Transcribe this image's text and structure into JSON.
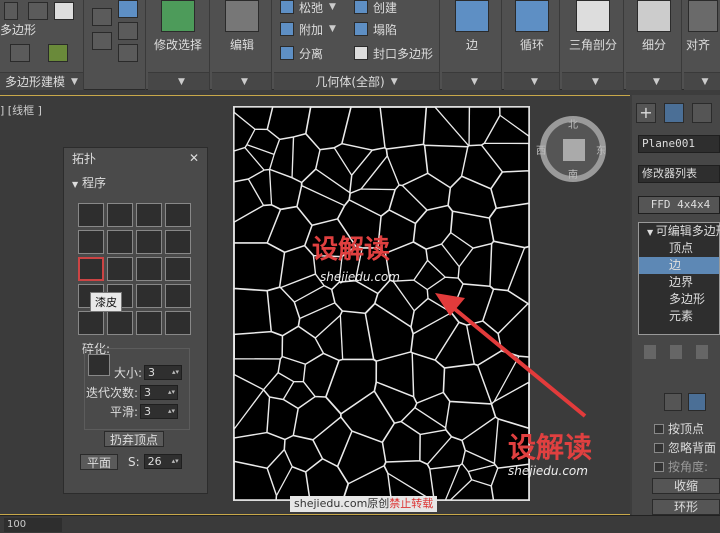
{
  "ribbon": {
    "left": {
      "label_multi": "多边形",
      "footer": "多边形建模"
    },
    "modify_select": "修改选择",
    "edit": "编辑",
    "geometry": {
      "relax": "松弛",
      "attach": "附加",
      "detach": "分离",
      "create": "创建",
      "collapse": "塌陷",
      "cap_poly": "封口多边形",
      "footer": "几何体(全部)"
    },
    "edge": "边",
    "loop": "循环",
    "tri_subdiv": "三角剖分",
    "subdiv": "细分",
    "align": "对齐"
  },
  "viewport": {
    "label": "] [线框 ]",
    "viewcube": {
      "north": "北",
      "south": "南",
      "west": "西",
      "east": "东"
    }
  },
  "topology": {
    "title": "拓扑",
    "section": "程序",
    "tooltip": "漆皮",
    "fracture_label": "碎化:",
    "size_label": "大小:",
    "size_value": "3",
    "iter_label": "迭代次数:",
    "iter_value": "3",
    "smooth_label": "平滑:",
    "smooth_value": "3",
    "discard_verts": "扔弃顶点",
    "plane_button": "平面",
    "s_label": "S:",
    "s_value": "26"
  },
  "command_panel": {
    "object_name": "Plane001",
    "modifier_list": "修改器列表",
    "ffd": "FFD 4x4x4",
    "stack": {
      "top": "可编辑多边形",
      "items": [
        "顶点",
        "边",
        "边界",
        "多边形",
        "元素"
      ],
      "selected": "边"
    },
    "by_vertex": "按顶点",
    "ignore_back": "忽略背面",
    "by_angle": "按角度:",
    "shrink": "收缩",
    "ring": "环形"
  },
  "status": {
    "value": "100"
  },
  "watermark": {
    "brand": "设解读",
    "url": "shejiedu.com",
    "credit_prefix": "shejiedu.com原创",
    "credit_red": "禁止转载"
  }
}
